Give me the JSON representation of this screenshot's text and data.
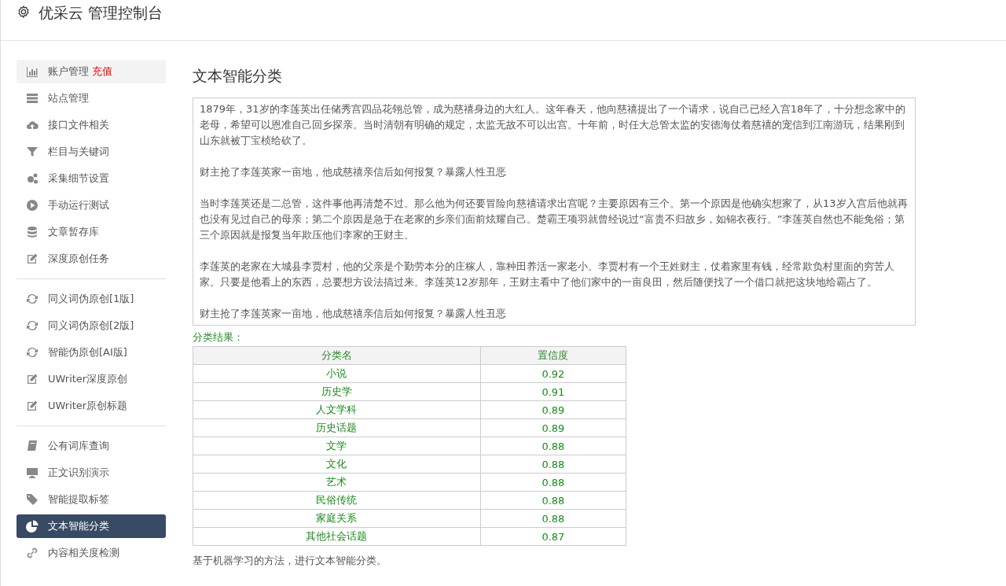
{
  "header": {
    "title": "优采云 管理控制台"
  },
  "sidebar": {
    "groups": [
      {
        "items": [
          {
            "label": "账户管理",
            "badge": "充值",
            "hovered": true,
            "selected": false
          },
          {
            "label": "站点管理",
            "hovered": false,
            "selected": false
          },
          {
            "label": "接口文件相关",
            "hovered": false,
            "selected": false
          },
          {
            "label": "栏目与关键词",
            "hovered": false,
            "selected": false
          },
          {
            "label": "采集细节设置",
            "hovered": false,
            "selected": false
          },
          {
            "label": "手动运行测试",
            "hovered": false,
            "selected": false
          },
          {
            "label": "文章暂存库",
            "hovered": false,
            "selected": false
          },
          {
            "label": "深度原创任务",
            "hovered": false,
            "selected": false
          }
        ]
      },
      {
        "items": [
          {
            "label": "同义词伪原创[1版]",
            "hovered": false,
            "selected": false
          },
          {
            "label": "同义词伪原创[2版]",
            "hovered": false,
            "selected": false
          },
          {
            "label": "智能伪原创[AI版]",
            "hovered": false,
            "selected": false
          },
          {
            "label": "UWriter深度原创",
            "hovered": false,
            "selected": false
          },
          {
            "label": "UWriter原创标题",
            "hovered": false,
            "selected": false
          }
        ]
      },
      {
        "items": [
          {
            "label": "公有词库查询",
            "hovered": false,
            "selected": false
          },
          {
            "label": "正文识别演示",
            "hovered": false,
            "selected": false
          },
          {
            "label": "智能提取标签",
            "hovered": false,
            "selected": false
          },
          {
            "label": "文本智能分类",
            "hovered": false,
            "selected": true
          },
          {
            "label": "内容相关度检测",
            "hovered": false,
            "selected": false
          }
        ]
      }
    ]
  },
  "main": {
    "title": "文本智能分类",
    "text_input": {
      "paragraphs": [
        "1879年，31岁的李莲英出任储秀宫四品花翎总管，成为慈禧身边的大红人。这年春天，他向慈禧提出了一个请求，说自己已经入宫18年了，十分想念家中的老母，希望可以恩准自己回乡探亲。当时清朝有明确的规定，太监无故不可以出宫。十年前，时任大总管太监的安德海仗着慈禧的宠信到江南游玩，结果刚到山东就被丁宝桢给砍了。",
        "财主抢了李莲英家一亩地，他成慈禧亲信后如何报复？暴露人性丑恶",
        "当时李莲英还是二总管，这件事他再清楚不过。那么他为何还要冒险向慈禧请求出宫呢？主要原因有三个。第一个原因是他确实想家了，从13岁入宫后他就再也没有见过自己的母亲；第二个原因是急于在老家的乡亲们面前炫耀自己。楚霸王项羽就曾经说过“富贵不归故乡，如锦衣夜行。”李莲英自然也不能免俗；第三个原因就是报复当年欺压他们李家的王财主。",
        "李莲英的老家在大城县李贾村，他的父亲是个勤劳本分的庄稼人，靠种田养活一家老小。李贾村有一个王姓财主，仗着家里有钱，经常欺负村里面的穷苦人家。只要是他看上的东西，总要想方设法搞过来。李莲英12岁那年，王财主看中了他们家中的一亩良田，然后随便找了一个借口就把这块地给霸占了。",
        "财主抢了李莲英家一亩地，他成慈禧亲信后如何报复？暴露人性丑恶"
      ]
    },
    "result_label": "分类结果：",
    "table": {
      "columns": [
        "分类名",
        "置信度"
      ],
      "rows": [
        [
          "小说",
          "0.92"
        ],
        [
          "历史学",
          "0.91"
        ],
        [
          "人文学科",
          "0.89"
        ],
        [
          "历史话题",
          "0.89"
        ],
        [
          "文学",
          "0.88"
        ],
        [
          "文化",
          "0.88"
        ],
        [
          "艺术",
          "0.88"
        ],
        [
          "民俗传统",
          "0.88"
        ],
        [
          "家庭关系",
          "0.88"
        ],
        [
          "其他社会话题",
          "0.87"
        ]
      ]
    },
    "footnote": "基于机器学习的方法，进行文本智能分类。"
  }
}
